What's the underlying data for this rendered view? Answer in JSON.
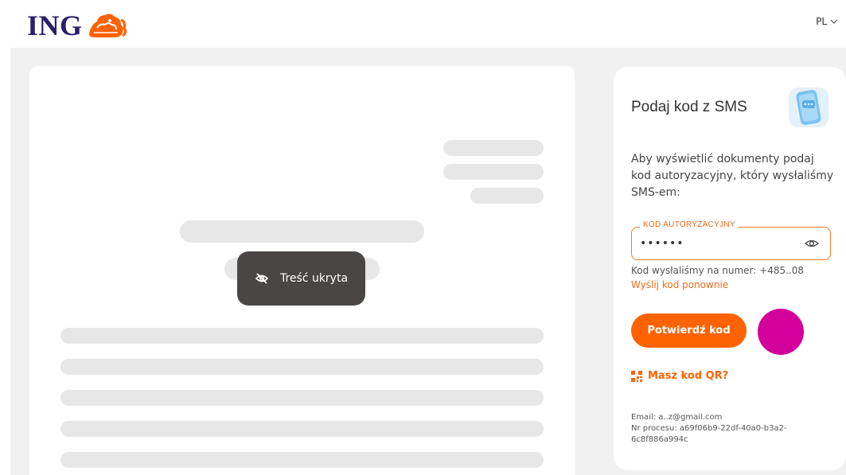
{
  "header": {
    "logo_text": "ING",
    "language": "PL"
  },
  "document": {
    "hidden_label": "Treść ukryta"
  },
  "sms_panel": {
    "title": "Podaj kod z SMS",
    "description": "Aby wyświetlić dokumenty podaj kod autoryzacyjny, który wysłaliśmy SMS-em:",
    "field_label": "KOD AUTORYZACYJNY",
    "field_value": "••••••",
    "sent_to": "Kod wysłaliśmy na numer: +485..08",
    "resend_label": "Wyślij kod ponownie",
    "confirm_label": "Potwierdź kod",
    "qr_label": "Masz kod QR?",
    "email": "Email: a..z@gmail.com",
    "process_id": "Nr procesu: a69f06b9-22df-40a0-b3a2-6c8f886a994c"
  },
  "colors": {
    "accent": "#ff6200",
    "brand_navy": "#2b1f6b",
    "marker": "#d4009b"
  }
}
